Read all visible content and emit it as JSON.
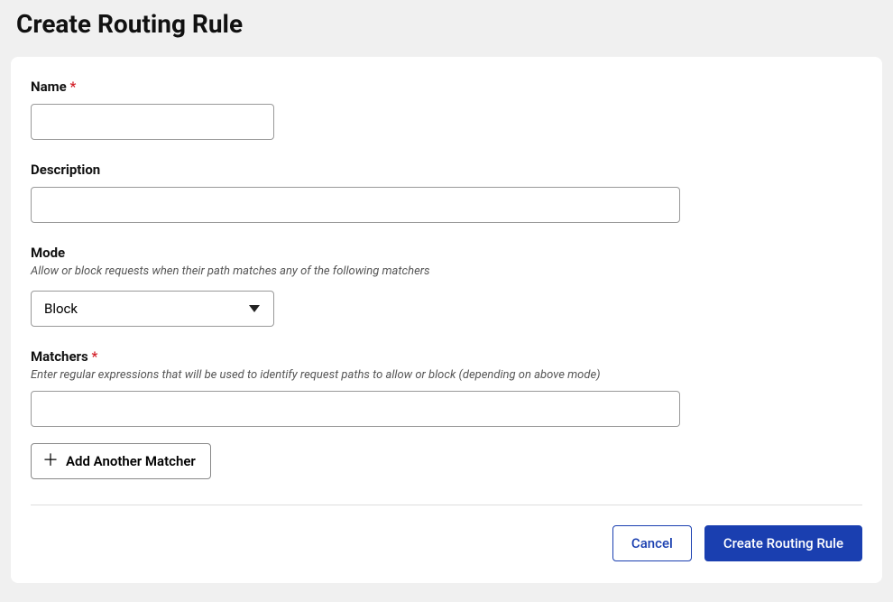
{
  "page": {
    "title": "Create Routing Rule"
  },
  "form": {
    "name": {
      "label": "Name",
      "value": ""
    },
    "description": {
      "label": "Description",
      "value": ""
    },
    "mode": {
      "label": "Mode",
      "help": "Allow or block requests when their path matches any of the following matchers",
      "selected": "Block"
    },
    "matchers": {
      "label": "Matchers",
      "help": "Enter regular expressions that will be used to identify request paths to allow or block (depending on above mode)",
      "value": "",
      "add_label": "Add Another Matcher"
    }
  },
  "actions": {
    "cancel": "Cancel",
    "submit": "Create Routing Rule"
  },
  "required_mark": "*"
}
